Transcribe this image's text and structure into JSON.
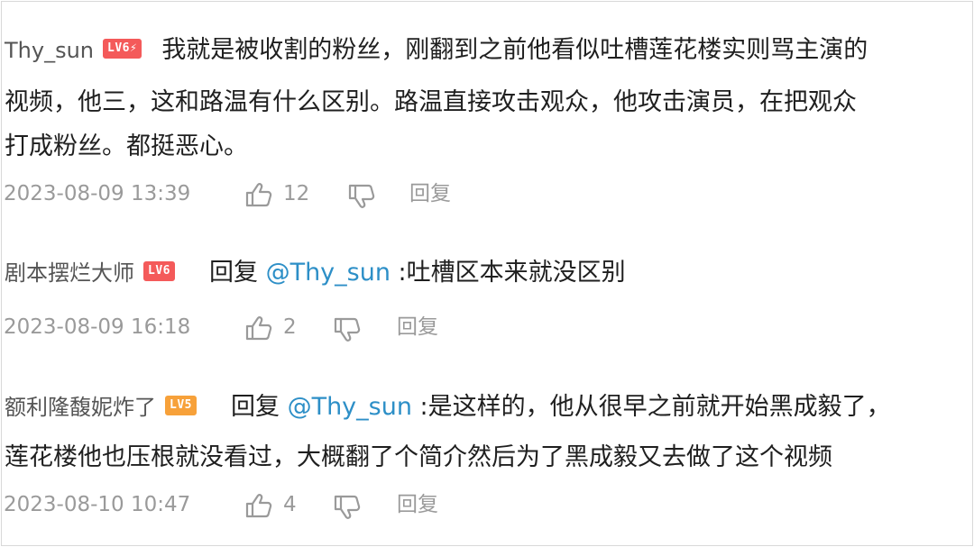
{
  "comments": [
    {
      "username": "Thy_sun",
      "level": "LV6",
      "level_color": "#f45a5a",
      "text_lines": [
        "我就是被收割的粉丝，刚翻到之前他看似吐槽莲花楼实则骂主演的",
        "视频，他三，这和路温有什么区别。路温直接攻击观众，他攻击演员，在把观众",
        "打成粉丝。都挺恶心。"
      ],
      "timestamp": "2023-08-09 13:39",
      "likes": "12",
      "reply_label": "回复"
    },
    {
      "username": "剧本摆烂大师",
      "level": "LV6",
      "level_color": "#f45a5a",
      "reply_word": "回复",
      "mention": "@Thy_sun",
      "text_lines": [
        ":吐槽区本来就没区别"
      ],
      "timestamp": "2023-08-09 16:18",
      "likes": "2",
      "reply_label": "回复"
    },
    {
      "username": "额利隆馥妮炸了",
      "level": "LV5",
      "level_color": "#f7a13a",
      "reply_word": "回复",
      "mention": "@Thy_sun",
      "text_lines": [
        ":是这样的，他从很早之前就开始黑成毅了，",
        "莲花楼他也压根就没看过，大概翻了个简介然后为了黑成毅又去做了这个视频"
      ],
      "timestamp": "2023-08-10 10:47",
      "likes": "4",
      "reply_label": "回复"
    }
  ],
  "icons": {
    "like": "thumbs-up-icon",
    "dislike": "thumbs-down-icon",
    "lightning": "lightning-icon"
  },
  "colors": {
    "mention": "#2d8fc7",
    "meta": "#9a9a9a",
    "text": "#1f1f1f"
  }
}
